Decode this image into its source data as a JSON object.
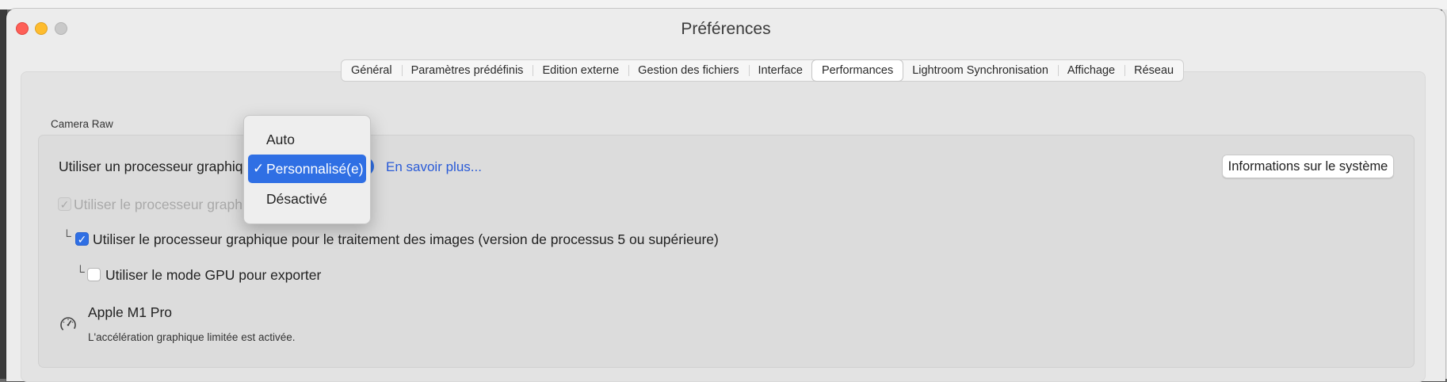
{
  "window": {
    "title": "Préférences"
  },
  "tabs": [
    {
      "label": "Général"
    },
    {
      "label": "Paramètres prédéfinis"
    },
    {
      "label": "Edition externe"
    },
    {
      "label": "Gestion des fichiers"
    },
    {
      "label": "Interface"
    },
    {
      "label": "Performances",
      "active": true
    },
    {
      "label": "Lightroom Synchronisation"
    },
    {
      "label": "Affichage"
    },
    {
      "label": "Réseau"
    }
  ],
  "camera_raw": {
    "section_label": "Camera Raw",
    "gpu_label": "Utiliser un processeur graphique :",
    "learn_more": "En savoir plus...",
    "system_info_button": "Informations sur le système",
    "gpu_display_option": "Utiliser le processeur graphique",
    "gpu_processing_option": "Utiliser le processeur graphique pour le traitement des images (version de processus 5 ou supérieure)",
    "gpu_export_option": "Utiliser le mode GPU pour exporter",
    "tree_connector": "└",
    "chip_name": "Apple M1 Pro",
    "chip_status": "L'accélération graphique limitée est activée."
  },
  "dropdown": {
    "options": [
      "Auto",
      "Personnalisé(e)",
      "Désactivé"
    ],
    "selected": "Personnalisé(e)",
    "check_glyph": "✓"
  },
  "checkboxes": {
    "gpu_display_checked": true,
    "gpu_display_enabled": false,
    "gpu_processing_checked": true,
    "gpu_export_checked": false
  },
  "colors": {
    "accent": "#2f6fe4",
    "link": "#2a5bd7",
    "close": "#fe5f57",
    "minimize": "#febc2e"
  }
}
